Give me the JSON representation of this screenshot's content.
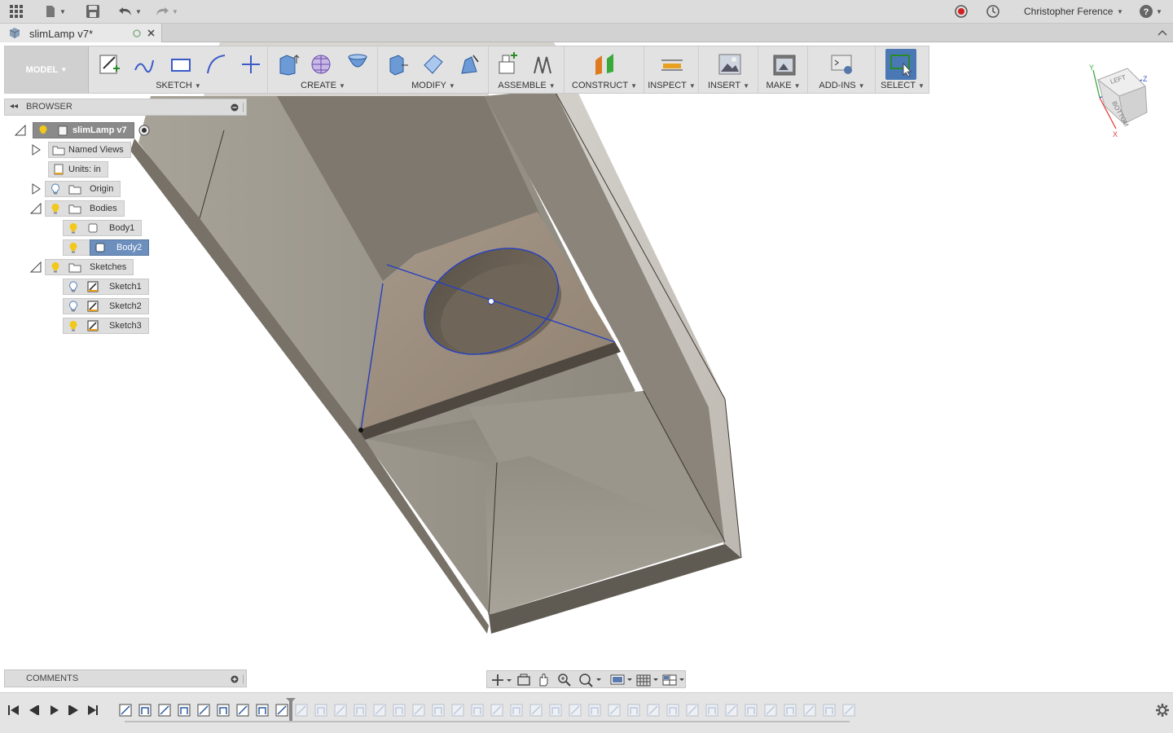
{
  "app": {
    "user_name": "Christopher Ference",
    "icons": [
      "apps-grid-icon",
      "file-icon",
      "save-icon",
      "undo-icon",
      "redo-icon",
      "record-icon",
      "history-clock-icon",
      "help-icon"
    ]
  },
  "document_tab": {
    "title": "slimLamp v7*"
  },
  "toolbar": {
    "workspace": "MODEL",
    "groups": [
      {
        "label": "SKETCH",
        "icons": [
          "create-sketch-icon",
          "line-icon",
          "rectangle-icon",
          "arc-icon",
          "point-icon"
        ]
      },
      {
        "label": "CREATE",
        "icons": [
          "extrude-icon",
          "form-icon",
          "revolve-icon"
        ]
      },
      {
        "label": "MODIFY",
        "icons": [
          "press-pull-icon",
          "fillet-icon",
          "chamfer-icon"
        ]
      },
      {
        "label": "ASSEMBLE",
        "icons": [
          "new-component-icon",
          "joint-icon"
        ]
      },
      {
        "label": "CONSTRUCT",
        "icons": [
          "offset-plane-icon"
        ]
      },
      {
        "label": "INSPECT",
        "icons": [
          "measure-icon"
        ]
      },
      {
        "label": "INSERT",
        "icons": [
          "insert-image-icon"
        ]
      },
      {
        "label": "MAKE",
        "icons": [
          "print-3d-icon"
        ]
      },
      {
        "label": "ADD-INS",
        "icons": [
          "scripts-icon"
        ]
      },
      {
        "label": "SELECT",
        "icons": [
          "select-window-icon"
        ]
      }
    ]
  },
  "browser": {
    "title": "BROWSER",
    "root": "slimLamp v7",
    "items": [
      {
        "label": "Named Views"
      },
      {
        "label": "Units: in"
      },
      {
        "label": "Origin"
      },
      {
        "label": "Bodies"
      },
      {
        "label": "Body1"
      },
      {
        "label": "Body2"
      },
      {
        "label": "Sketches"
      },
      {
        "label": "Sketch1"
      },
      {
        "label": "Sketch2"
      },
      {
        "label": "Sketch3"
      }
    ]
  },
  "viewcube": {
    "face_left": "LEFT",
    "face_bottom": "BOTTOM",
    "axis_x": "X",
    "axis_y": "Y",
    "axis_z": "Z"
  },
  "comments": {
    "title": "COMMENTS"
  },
  "colors": {
    "accent_select": "#4a78b4",
    "sketch_line": "#2540c0",
    "body_face": "#a9a398",
    "selected_tree": "#6d8fbd"
  }
}
